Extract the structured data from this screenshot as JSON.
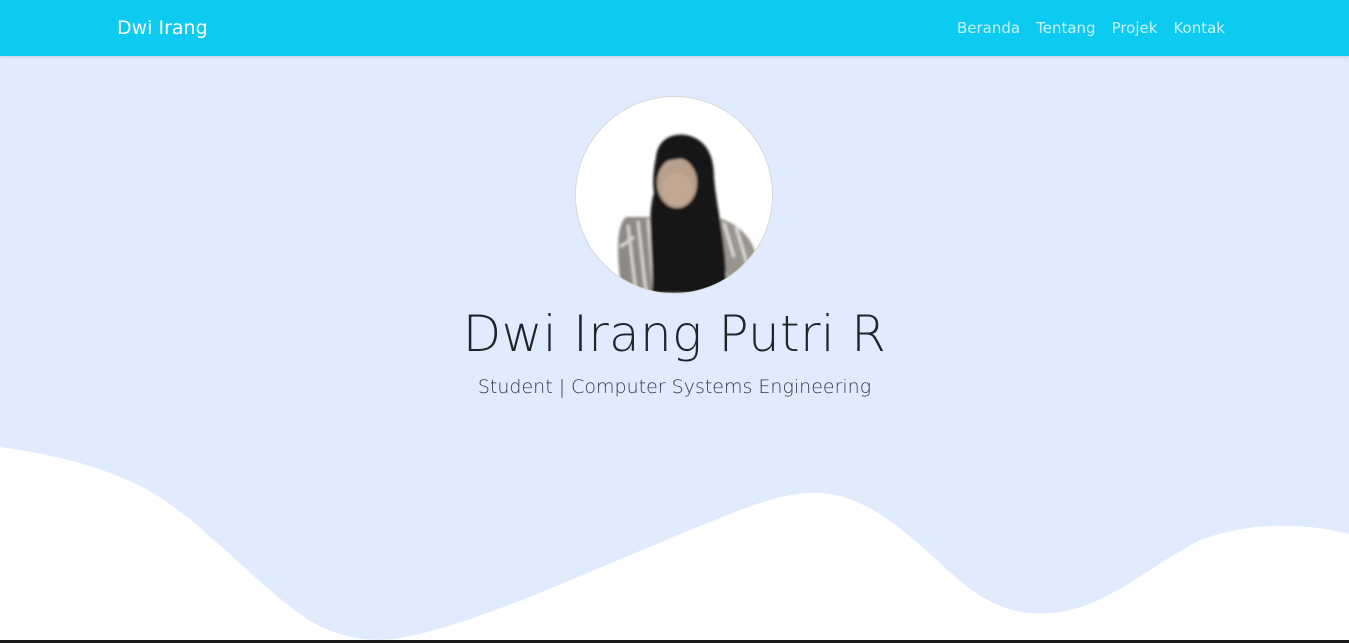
{
  "navbar": {
    "brand": "Dwi Irang",
    "links": [
      {
        "label": "Beranda"
      },
      {
        "label": "Tentang"
      },
      {
        "label": "Projek"
      },
      {
        "label": "Kontak"
      }
    ],
    "background_color": "#0dcaf0"
  },
  "hero": {
    "name": "Dwi Irang Putri R",
    "subtitle": "Student | Computer Systems Engineering",
    "background_color": "#e0ebfd",
    "avatar_icon": "profile-photo"
  }
}
